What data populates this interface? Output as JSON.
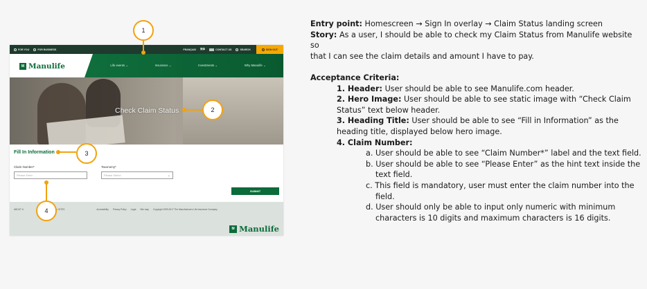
{
  "mockup": {
    "util_bar": {
      "for_you": "FOR YOU",
      "for_business": "FOR BUSINESS",
      "francais": "FRANÇAIS",
      "lang2": "简体",
      "contact_us": "CONTACT US",
      "search": "SEARCH",
      "sign_out": "SIGN OUT"
    },
    "logo": "Manulife",
    "logo_mark": "M",
    "nav": [
      "Life events ⌄",
      "Insurance ⌄",
      "Investments ⌄",
      "Why Manulife ⌄"
    ],
    "hero_text": "Check Claim Status",
    "heading": "Fill In Information",
    "claim_label": "Claim Number*",
    "claim_placeholder": "Please Enter",
    "taxonomy_label": "Taxonomy*",
    "taxonomy_placeholder": "Please Select",
    "submit": "SUBMIT",
    "footer_left": "ABOUT U",
    "footer_intl": "INTERNATIONAL SITES",
    "footer_links": [
      "Accessibility",
      "Privacy Policy",
      "Legal",
      "Site map",
      "Copyright 1999-2017 The Manufacturers Life Insurance Company"
    ],
    "footer_logo": "Manulife",
    "callouts": [
      "1",
      "2",
      "3",
      "4"
    ]
  },
  "doc": {
    "entry_label": "Entry point:",
    "entry_text": " Homescreen → Sign In overlay → Claim Status landing screen",
    "story_label": "Story:",
    "story_text_1": " As a user, I should be able to check my Claim Status from Manulife website so",
    "story_text_2": "that I can see the claim details and amount I have to pay.",
    "ac_title": "Acceptance Criteria:",
    "c1_label": "1. Header:",
    "c1_text": " User should be able to see Manulife.com header.",
    "c2_label": "2. Hero Image:",
    "c2_text_1": " User should be able to see static image with “Check Claim",
    "c2_text_2": "Status” text below header.",
    "c3_label": "3. Heading Title:",
    "c3_text_1": " User should be able to see “Fill in Information” as the",
    "c3_text_2": "heading title, displayed below hero image.",
    "c4_label": "4. Claim Number:",
    "a_1": "a. User should be able to see “Claim Number*” label and the text field.",
    "b_1": "b. User should be able to see “Please Enter” as the hint text inside the",
    "b_2": "text field.",
    "c_1": "c. This field is mandatory, user must enter the claim number into the",
    "c_2": "field.",
    "d_1": "d. User should only be able to input only numeric with minimum",
    "d_2": "characters is 10 digits and maximum characters is 16 digits."
  }
}
